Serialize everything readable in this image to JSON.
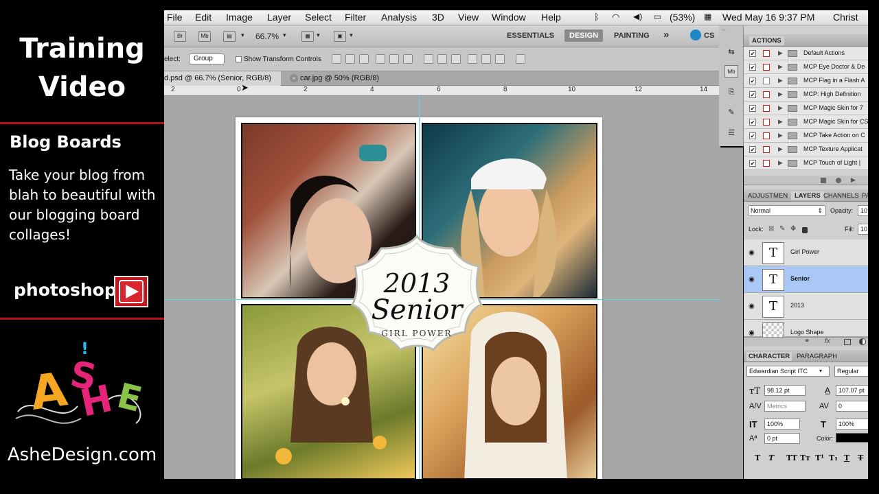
{
  "sidebar": {
    "title_line1": "Training",
    "title_line2": "Video",
    "section_title": "Blog Boards",
    "description": "Take your blog from blah to beautiful with our blogging board collages!",
    "app_label": "photoshop",
    "logo_text": "ASHE",
    "site": "AsheDesign.com"
  },
  "menubar": {
    "items": [
      "File",
      "Edit",
      "Image",
      "Layer",
      "Select",
      "Filter",
      "Analysis",
      "3D",
      "View",
      "Window",
      "Help"
    ],
    "battery": "(53%)",
    "clock": "Wed May 16  9:37 PM",
    "user": "Christ"
  },
  "appbar": {
    "zoom": "66.7%",
    "workspaces": [
      "ESSENTIALS",
      "DESIGN",
      "PAINTING"
    ],
    "more": "»",
    "cs": "CS"
  },
  "options": {
    "select_label": "elect:",
    "select_value": "Group",
    "transform_label": "Show Transform Controls"
  },
  "tabs": [
    {
      "label": "d.psd @ 66.7% (Senior, RGB/8) *"
    },
    {
      "label": "car.jpg @ 50% (RGB/8)"
    }
  ],
  "ruler": {
    "marks": [
      "2",
      "0",
      "2",
      "4",
      "6",
      "8",
      "10",
      "12",
      "14"
    ]
  },
  "badge": {
    "year": "2013",
    "title": "Senior",
    "subtitle": "GIRL POWER"
  },
  "actions": {
    "header": "ACTIONS",
    "items": [
      "Default Actions",
      "MCP Eye Doctor & De",
      "MCP Flag in a Flash A",
      "MCP: High Definition",
      "MCP Magic Skin for 7",
      "MCP Magic Skin for CS",
      "MCP Take Action on C",
      "MCP Texture Applicat",
      "MCP Touch of Light |"
    ]
  },
  "layers_panel": {
    "tabs": [
      "ADJUSTMEN",
      "LAYERS",
      "CHANNELS",
      "PA"
    ],
    "blend_mode": "Normal",
    "opacity_label": "Opacity:",
    "opacity_value": "10",
    "lock_label": "Lock:",
    "fill_label": "Fill:",
    "fill_value": "10",
    "layers": [
      {
        "name": "Girl Power",
        "thumb": "T"
      },
      {
        "name": "Senior",
        "thumb": "T"
      },
      {
        "name": "2013",
        "thumb": "T"
      },
      {
        "name": "Logo Shape",
        "thumb": ""
      }
    ]
  },
  "character_panel": {
    "tabs": [
      "CHARACTER",
      "PARAGRAPH"
    ],
    "font_family": "Edwardian Script ITC",
    "font_style": "Regular",
    "font_size": "98.12 pt",
    "leading": "107.07 pt",
    "kerning": "Metrics",
    "tracking": "0",
    "vscale": "100%",
    "hscale": "100%",
    "baseline": "0 pt",
    "color_label": "Color:"
  },
  "colors": {
    "accent_red": "#b3121b",
    "guide": "#5fd9e6",
    "selected_layer": "#a9c8f5"
  }
}
